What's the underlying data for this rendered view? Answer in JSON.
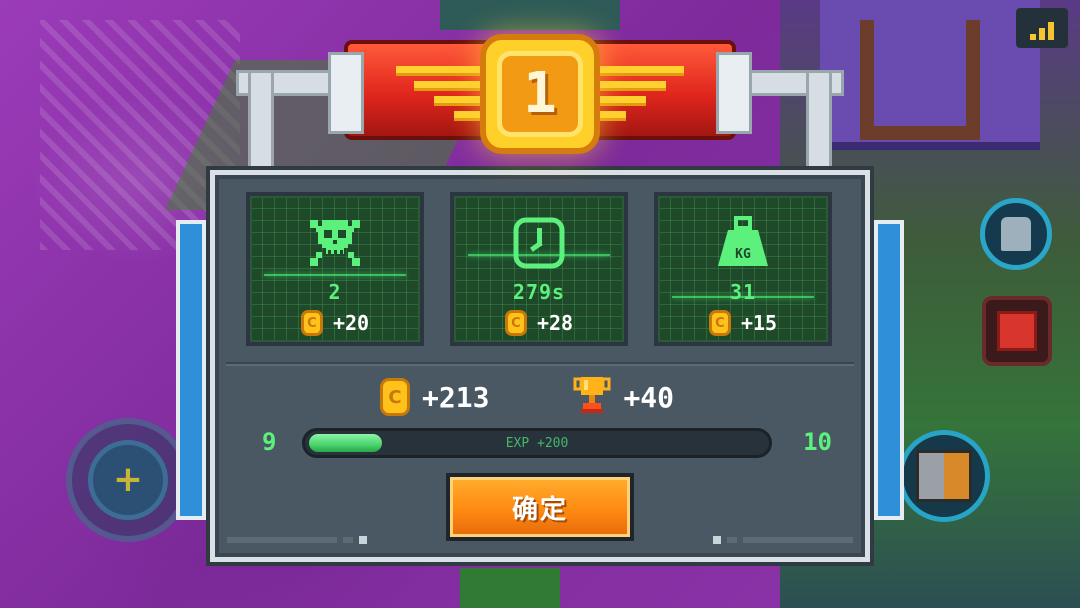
{
  "rank": "1",
  "stats": [
    {
      "icon": "skull-crossbones-icon",
      "value": "2",
      "reward": "+20"
    },
    {
      "icon": "clock-icon",
      "value": "279s",
      "reward": "+28"
    },
    {
      "icon": "weight-kg-icon",
      "value": "31",
      "reward": "+15",
      "weight_label": "KG"
    }
  ],
  "totals": {
    "coins": "+213",
    "trophies": "+40"
  },
  "exp": {
    "level_from": "9",
    "level_to": "10",
    "label": "EXP +200",
    "progress": 0.16
  },
  "confirm_label": "确定",
  "colors": {
    "accent_green": "#5cf07c",
    "banner_red": "#e0261d",
    "medal_gold": "#ffcf2a",
    "button_orange": "#ff8a12",
    "panel_bg": "#4a5863"
  }
}
